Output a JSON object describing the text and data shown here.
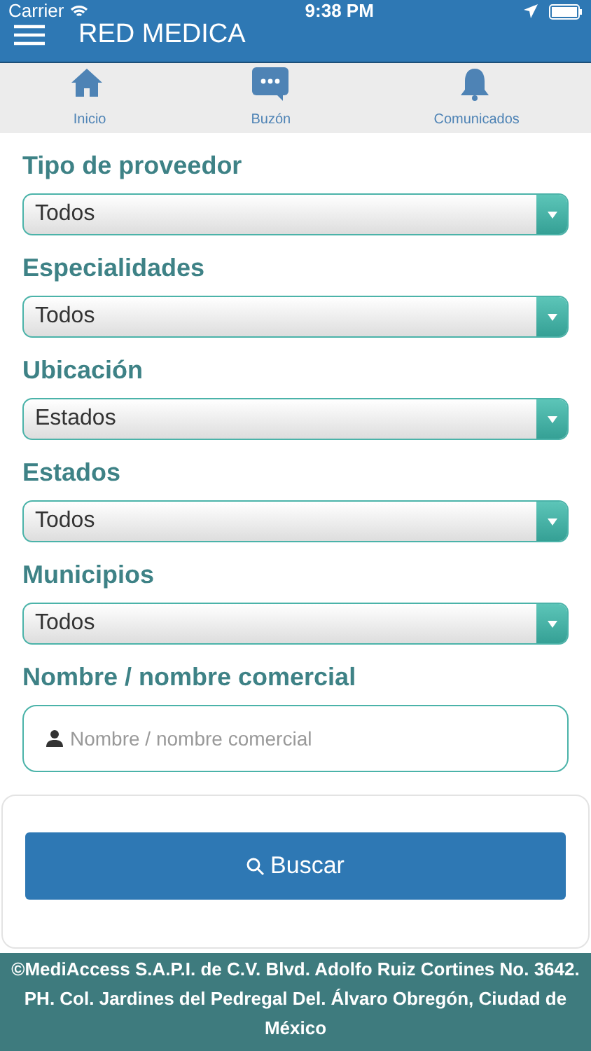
{
  "status_bar": {
    "carrier": "Carrier",
    "time": "9:38 PM"
  },
  "header": {
    "title": "RED MEDICA"
  },
  "tabs": [
    {
      "label": "Inicio",
      "kind": "home"
    },
    {
      "label": "Buzón",
      "kind": "chat"
    },
    {
      "label": "Comunicados",
      "kind": "bell"
    }
  ],
  "filters": [
    {
      "label": "Tipo de proveedor",
      "value": "Todos"
    },
    {
      "label": "Especialidades",
      "value": "Todos"
    },
    {
      "label": "Ubicación",
      "value": "Estados"
    },
    {
      "label": "Estados",
      "value": "Todos"
    },
    {
      "label": "Municipios",
      "value": "Todos"
    }
  ],
  "name_field": {
    "label": "Nombre / nombre comercial",
    "placeholder": "Nombre / nombre comercial"
  },
  "search_button": "Buscar",
  "footer": "©MediAccess S.A.P.I. de C.V. Blvd. Adolfo Ruiz Cortines No. 3642. PH. Col. Jardines del Pedregal Del. Álvaro Obregón, Ciudad de México"
}
